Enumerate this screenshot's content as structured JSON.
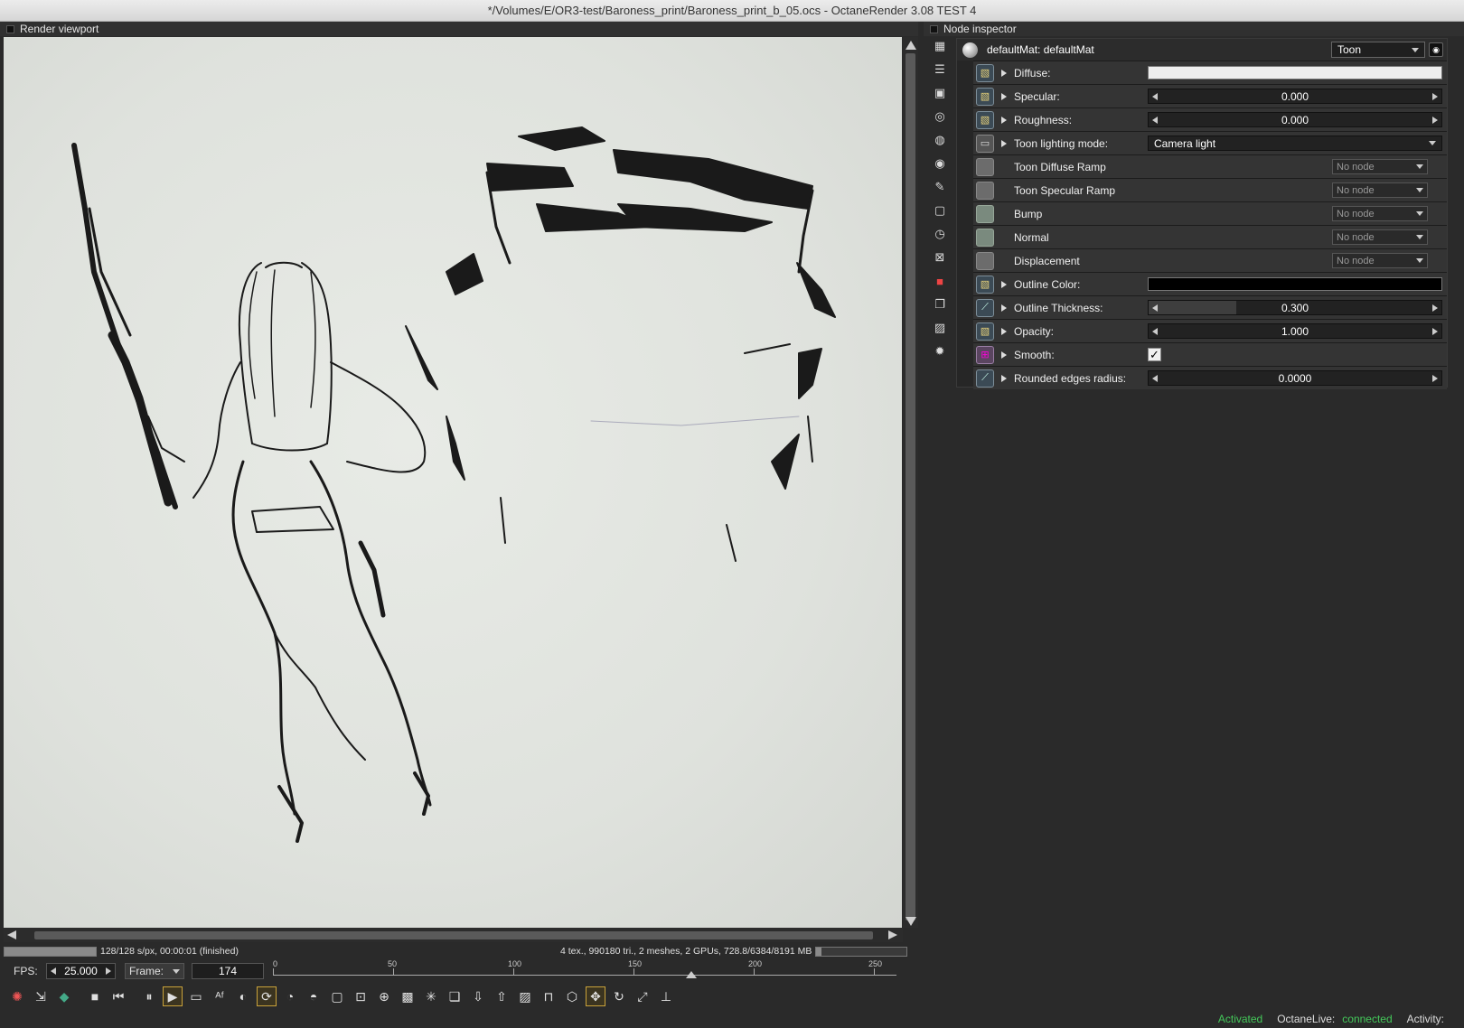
{
  "window": {
    "title": "*/Volumes/E/OR3-test/Baroness_print/Baroness_print_b_05.ocs - OctaneRender 3.08 TEST 4"
  },
  "render_viewport": {
    "title": "Render viewport",
    "status": "128/128 s/px, 00:00:01 (finished)",
    "progress_fraction": 1.0,
    "stats": "4 tex., 990180 tri., 2 meshes, 2 GPUs, 728.8/6384/8191 MB",
    "memory_fraction": 0.06,
    "fps_label": "FPS:",
    "fps_value": "25.000",
    "frame_label": "Frame:",
    "frame_value": "174",
    "timeline": {
      "min": 0,
      "max": 250,
      "current": 174,
      "ticks": [
        "0",
        "50",
        "100",
        "150",
        "200",
        "250"
      ]
    },
    "toolbar_icons": [
      "reset-icon",
      "denoise-icon",
      "cube-color-icon",
      "stop-icon",
      "rewind-icon",
      "pause-icon",
      "play-icon",
      "screen-icon",
      "af-icon",
      "color-picker-icon",
      "camera-sync-icon",
      "lens-icon",
      "material-picker-icon",
      "region-icon",
      "crop-icon",
      "zoom-icon",
      "grid-icon",
      "sparkle-icon",
      "copy-icon",
      "import-icon",
      "export-icon",
      "bake-icon",
      "lock-icon",
      "box-icon",
      "move-icon",
      "rotate-icon",
      "fullscreen-icon",
      "axis-icon"
    ]
  },
  "node_inspector": {
    "title": "Node inspector",
    "material_name": "defaultMat: defaultMat",
    "material_type": "Toon",
    "params": [
      {
        "label": "Diffuse:",
        "kind": "color",
        "color": "#eeeeee",
        "icon": "texture-icon",
        "expandable": true
      },
      {
        "label": "Specular:",
        "kind": "slider",
        "value": "0.000",
        "fill": 0.0,
        "icon": "texture-icon",
        "expandable": true
      },
      {
        "label": "Roughness:",
        "kind": "slider",
        "value": "0.000",
        "fill": 0.0,
        "icon": "texture-icon",
        "expandable": true
      },
      {
        "label": "Toon lighting mode:",
        "kind": "combo",
        "value": "Camera light",
        "icon": "enum-icon",
        "expandable": true
      },
      {
        "label": "Toon Diffuse Ramp",
        "kind": "nonode",
        "value": "No node",
        "icon": "empty-pin-icon",
        "expandable": false
      },
      {
        "label": "Toon Specular Ramp",
        "kind": "nonode",
        "value": "No node",
        "icon": "empty-pin-icon",
        "expandable": false
      },
      {
        "label": "Bump",
        "kind": "nonode",
        "value": "No node",
        "icon": "green-pin-icon",
        "expandable": false
      },
      {
        "label": "Normal",
        "kind": "nonode",
        "value": "No node",
        "icon": "green-pin-icon",
        "expandable": false
      },
      {
        "label": "Displacement",
        "kind": "nonode",
        "value": "No node",
        "icon": "empty-pin-icon",
        "expandable": false
      },
      {
        "label": "Outline Color:",
        "kind": "color",
        "color": "#000000",
        "icon": "texture-icon",
        "expandable": true
      },
      {
        "label": "Outline Thickness:",
        "kind": "slider",
        "value": "0.300",
        "fill": 0.3,
        "icon": "float-icon",
        "expandable": true
      },
      {
        "label": "Opacity:",
        "kind": "slider",
        "value": "1.000",
        "fill": 0.0,
        "icon": "texture-icon",
        "expandable": true
      },
      {
        "label": "Smooth:",
        "kind": "bool",
        "value": "✓",
        "icon": "bool-icon",
        "expandable": true
      },
      {
        "label": "Rounded edges radius:",
        "kind": "slider",
        "value": "0.0000",
        "fill": 0.0,
        "icon": "float-icon",
        "expandable": true
      }
    ],
    "side_icons": [
      "nodegraph-icon",
      "outliner-icon",
      "image-icon",
      "camera-icon",
      "teapot-icon",
      "teapot-blue-icon",
      "paint-icon",
      "render-target-icon",
      "clock-icon",
      "network-icon",
      "red-cube-icon",
      "layers-icon",
      "picture-icon",
      "sun-icon"
    ]
  },
  "footer": {
    "activation": "Activated",
    "live_label": "OctaneLive:",
    "live_status": "connected",
    "activity_label": "Activity:"
  }
}
